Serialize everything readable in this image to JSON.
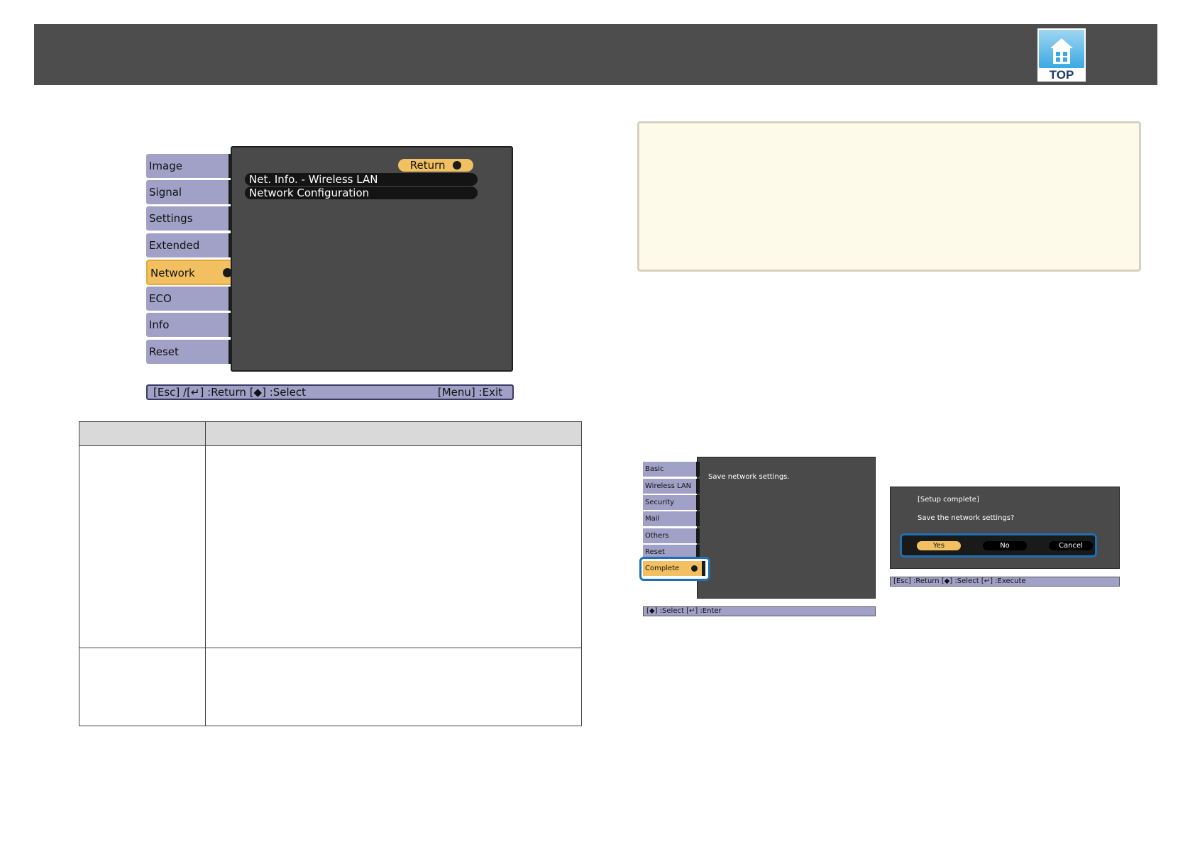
{
  "header": {
    "top_icon_label": "TOP"
  },
  "projector_menu": {
    "tabs": [
      {
        "label": "Image",
        "active": false
      },
      {
        "label": "Signal",
        "active": false
      },
      {
        "label": "Settings",
        "active": false
      },
      {
        "label": "Extended",
        "active": false
      },
      {
        "label": "Network",
        "active": true
      },
      {
        "label": "ECO",
        "active": false
      },
      {
        "label": "Info",
        "active": false
      },
      {
        "label": "Reset",
        "active": false
      }
    ],
    "return_label": "Return",
    "items": [
      "Net. Info. - Wireless LAN",
      "Network Configuration"
    ],
    "status_left": "[Esc] /[↵] :Return  [◆] :Select",
    "status_right": "[Menu] :Exit"
  },
  "complete_menu": {
    "tabs": [
      {
        "label": "Basic",
        "active": false
      },
      {
        "label": "Wireless LAN",
        "active": false
      },
      {
        "label": "Security",
        "active": false
      },
      {
        "label": "Mail",
        "active": false
      },
      {
        "label": "Others",
        "active": false
      },
      {
        "label": "Reset",
        "active": false
      },
      {
        "label": "Complete",
        "active": true
      }
    ],
    "panel_text": "Save network settings.",
    "status": "[◆] :Select  [↵] :Enter"
  },
  "confirm_dialog": {
    "title": "[Setup complete]",
    "question": "Save the network settings?",
    "yes": "Yes",
    "no": "No",
    "cancel": "Cancel",
    "status": "[Esc] :Return  [◆] :Select  [↵] :Execute"
  },
  "colors": {
    "header_bg": "#4d4d4d",
    "tab_bg": "#a1a0c6",
    "tab_active": "#f3c061",
    "panel_bg": "#4a4a4a",
    "note_bg": "#fefaea",
    "highlight": "#1f6fb3"
  }
}
